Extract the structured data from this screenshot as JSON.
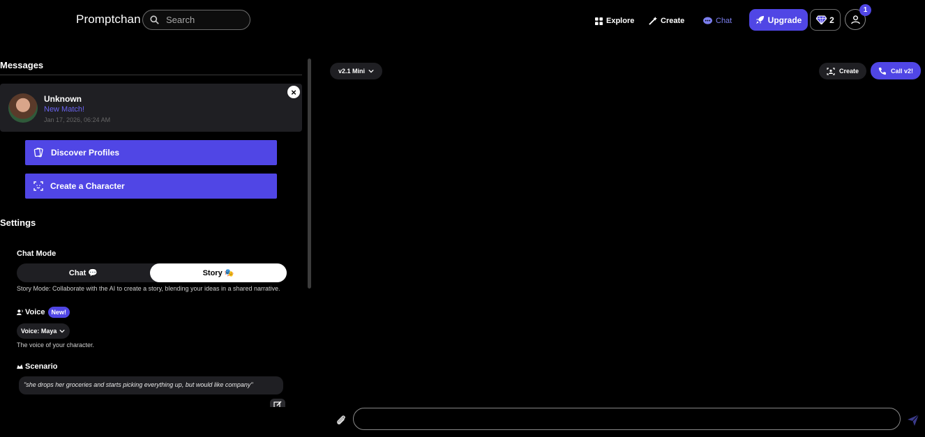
{
  "header": {
    "logo": "Promptchan",
    "search_placeholder": "Search",
    "nav": {
      "explore": "Explore",
      "create": "Create",
      "chat": "Chat"
    },
    "upgrade_label": "Upgrade",
    "gem_count": "2",
    "notification_count": "1"
  },
  "messages": {
    "title": "Messages",
    "match": {
      "name": "Unknown",
      "subtitle": "New Match!",
      "timestamp": "Jan 17, 2026, 06:24 AM"
    },
    "discover_label": "Discover Profiles",
    "create_character_label": "Create a Character"
  },
  "settings": {
    "title": "Settings",
    "chat_mode_label": "Chat Mode",
    "mode_chat": "Chat 💬",
    "mode_story": "Story 🎭",
    "mode_selected": "Story",
    "mode_hint": "Story Mode: Collaborate with the AI to create a story, blending your ideas in a shared narrative.",
    "voice_label": "Voice",
    "voice_badge": "New!",
    "voice_selected": "Voice: Maya",
    "voice_hint": "The voice of your character.",
    "scenario_label": "Scenario",
    "scenario_text": "\"she drops her groceries and starts picking everything up, but would like company\""
  },
  "chat": {
    "model_selected": "v2.1 Mini",
    "create_label": "Create",
    "call_label": "Call v2!",
    "input_value": ""
  },
  "colors": {
    "accent": "#5046e5",
    "panel": "#1f1f23",
    "background": "#000000"
  }
}
